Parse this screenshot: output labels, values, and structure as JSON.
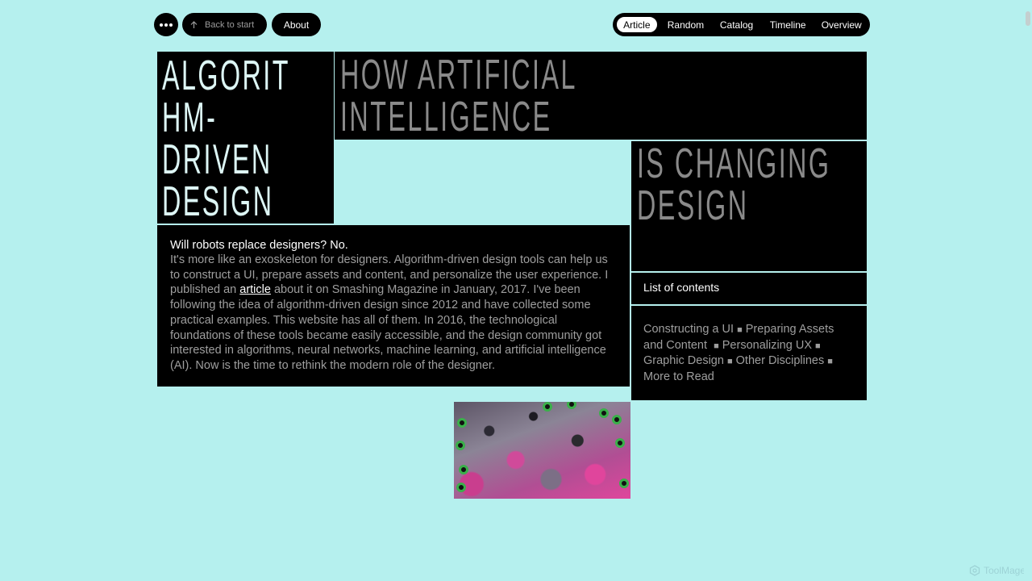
{
  "nav": {
    "menu_icon": "more-horizontal-icon",
    "back_label": "Back to start",
    "back_icon": "arrow-up-icon",
    "about_label": "About"
  },
  "tabs": [
    {
      "label": "Article",
      "active": true
    },
    {
      "label": "Random",
      "active": false
    },
    {
      "label": "Catalog",
      "active": false
    },
    {
      "label": "Timeline",
      "active": false
    },
    {
      "label": "Overview",
      "active": false
    }
  ],
  "title": {
    "left": "ALGORIT HM- DRIVEN DESIGN",
    "right_top": "HOW ARTIFICIAL INTELLIGENCE",
    "right_mid": "IS CHANGING DESIGN"
  },
  "article": {
    "lead": "Will robots replace designers? No.",
    "body_before_link": "It's more like an exoskeleton for designers. Algorithm-driven design tools can help us to construct a UI, prepare assets and content, and personalize the user experience. I published an ",
    "link_text": "article",
    "body_after_link": " about it on Smashing Magazine in January, 2017. I've been following the idea of algorithm-driven design since 2012 and have collected some practical examples. This website has all of them. In 2016, the technological foundations of these tools became easily accessible, and the design community got interested in algorithms, neural networks, machine learning, and artificial intelligence (AI). Now is the time to rethink the modern role of the designer."
  },
  "toc": {
    "heading": "List of contents",
    "items": [
      "Constructing a UI",
      "Preparing Assets and Content",
      "Personalizing UX",
      "Graphic Design",
      "Other Disciplines",
      "More to Read"
    ],
    "separator": "■"
  },
  "watermark": "ToolMage",
  "colors": {
    "background": "#b5f0ee",
    "block": "#000000",
    "title_light": "#ddf6f5",
    "title_gray": "#8a8a8a",
    "body_gray": "#9e9e9e"
  }
}
